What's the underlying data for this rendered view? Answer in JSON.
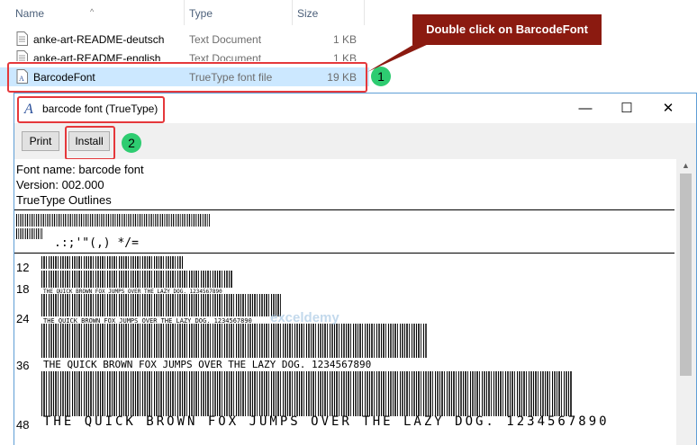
{
  "explorer": {
    "columns": {
      "name": "Name",
      "type": "Type",
      "size": "Size"
    },
    "files": [
      {
        "name": "anke-art-README-deutsch",
        "type": "Text Document",
        "size": "1 KB"
      },
      {
        "name": "anke-art-README-english",
        "type": "Text Document",
        "size": "1 KB"
      },
      {
        "name": "BarcodeFont",
        "type": "TrueType font file",
        "size": "19 KB"
      }
    ]
  },
  "annotations": {
    "callout": "Double click on BarcodeFont",
    "step1": "1",
    "step2": "2"
  },
  "window": {
    "title": "barcode font (TrueType)",
    "minimize": "—",
    "maximize": "☐",
    "close": "✕",
    "print_label": "Print",
    "install_label": "Install",
    "font_name": "Font name: barcode font",
    "version": "Version: 002.000",
    "outlines": "TrueType Outlines",
    "punctuation": ".:;'\"(,)  */=",
    "sample_text": "THE QUICK BROWN FOX JUMPS OVER THE LAZY DOG. 1234567890",
    "sizes": [
      "12",
      "18",
      "24",
      "36",
      "48"
    ]
  },
  "watermark": "exceldemy",
  "colors": {
    "highlight": "#e5383b",
    "badge": "#2ecc71",
    "callout_bg": "#8b1a10",
    "selection": "#cce8ff"
  }
}
